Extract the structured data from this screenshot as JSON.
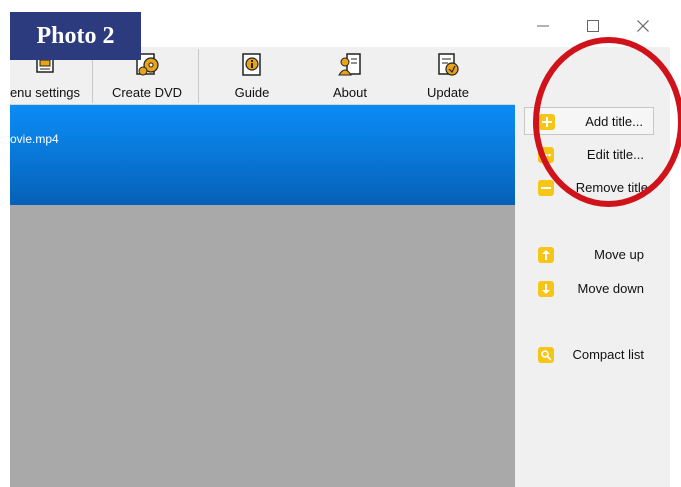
{
  "window": {
    "controls": {
      "minimize": "—",
      "maximize": "□",
      "close": "✕"
    }
  },
  "overlay": {
    "badge": "Photo 2",
    "circle_color": "#d0121b",
    "badge_color": "#2c3b7e"
  },
  "toolbar": {
    "items": [
      {
        "label": "enu settings",
        "icon": "menu-settings-icon"
      },
      {
        "label": "Create DVD",
        "icon": "create-dvd-icon"
      },
      {
        "label": "Guide",
        "icon": "guide-icon"
      },
      {
        "label": "About",
        "icon": "about-icon"
      },
      {
        "label": "Update",
        "icon": "update-icon"
      }
    ]
  },
  "titles": {
    "items": [
      {
        "name": "ovie.mp4",
        "selected": true
      }
    ],
    "selected_color": "#0978d8",
    "empty_color": "#a9a9a9"
  },
  "sidebar": {
    "items": [
      {
        "label": "Add title...",
        "icon": "plus-icon"
      },
      {
        "label": "Edit title...",
        "icon": "ellipsis-icon"
      },
      {
        "label": "Remove title",
        "icon": "minus-icon"
      },
      {
        "label": "Move up",
        "icon": "arrow-up-icon"
      },
      {
        "label": "Move down",
        "icon": "arrow-down-icon"
      },
      {
        "label": "Compact list",
        "icon": "compact-list-icon"
      }
    ],
    "icon_color": "#f5c518"
  }
}
